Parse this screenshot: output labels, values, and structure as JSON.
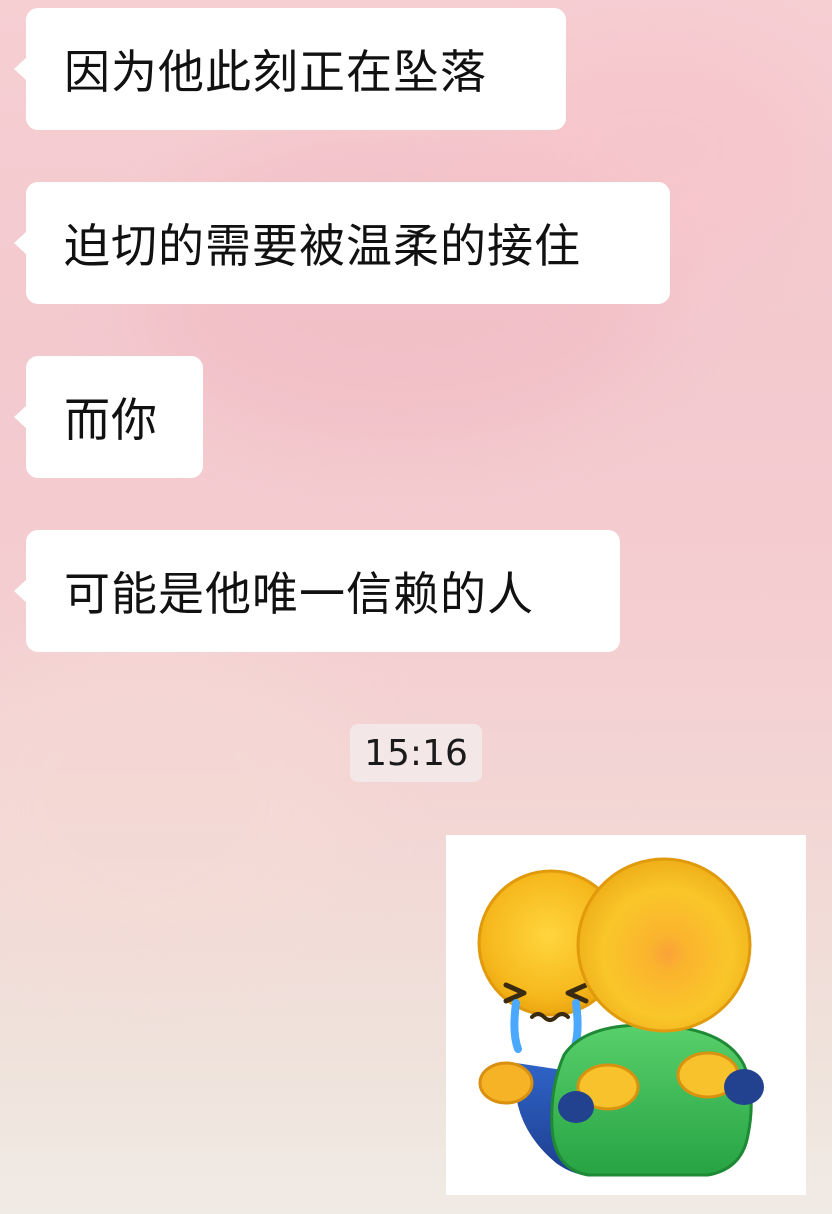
{
  "messages": [
    "因为他此刻正在坠落",
    "迫切的需要被温柔的接住",
    "而你",
    "可能是他唯一信赖的人"
  ],
  "timestamp": "15:16",
  "sticker": {
    "icon": "hug-emoji-sticker",
    "colors": {
      "face": "#f7c52b",
      "shirt": "#3fbf57",
      "pants": "#2a57b8",
      "tears": "#4aa8ff"
    }
  },
  "colors": {
    "bubble": "#ffffff",
    "text": "#111111",
    "background": "#f4ced1"
  }
}
